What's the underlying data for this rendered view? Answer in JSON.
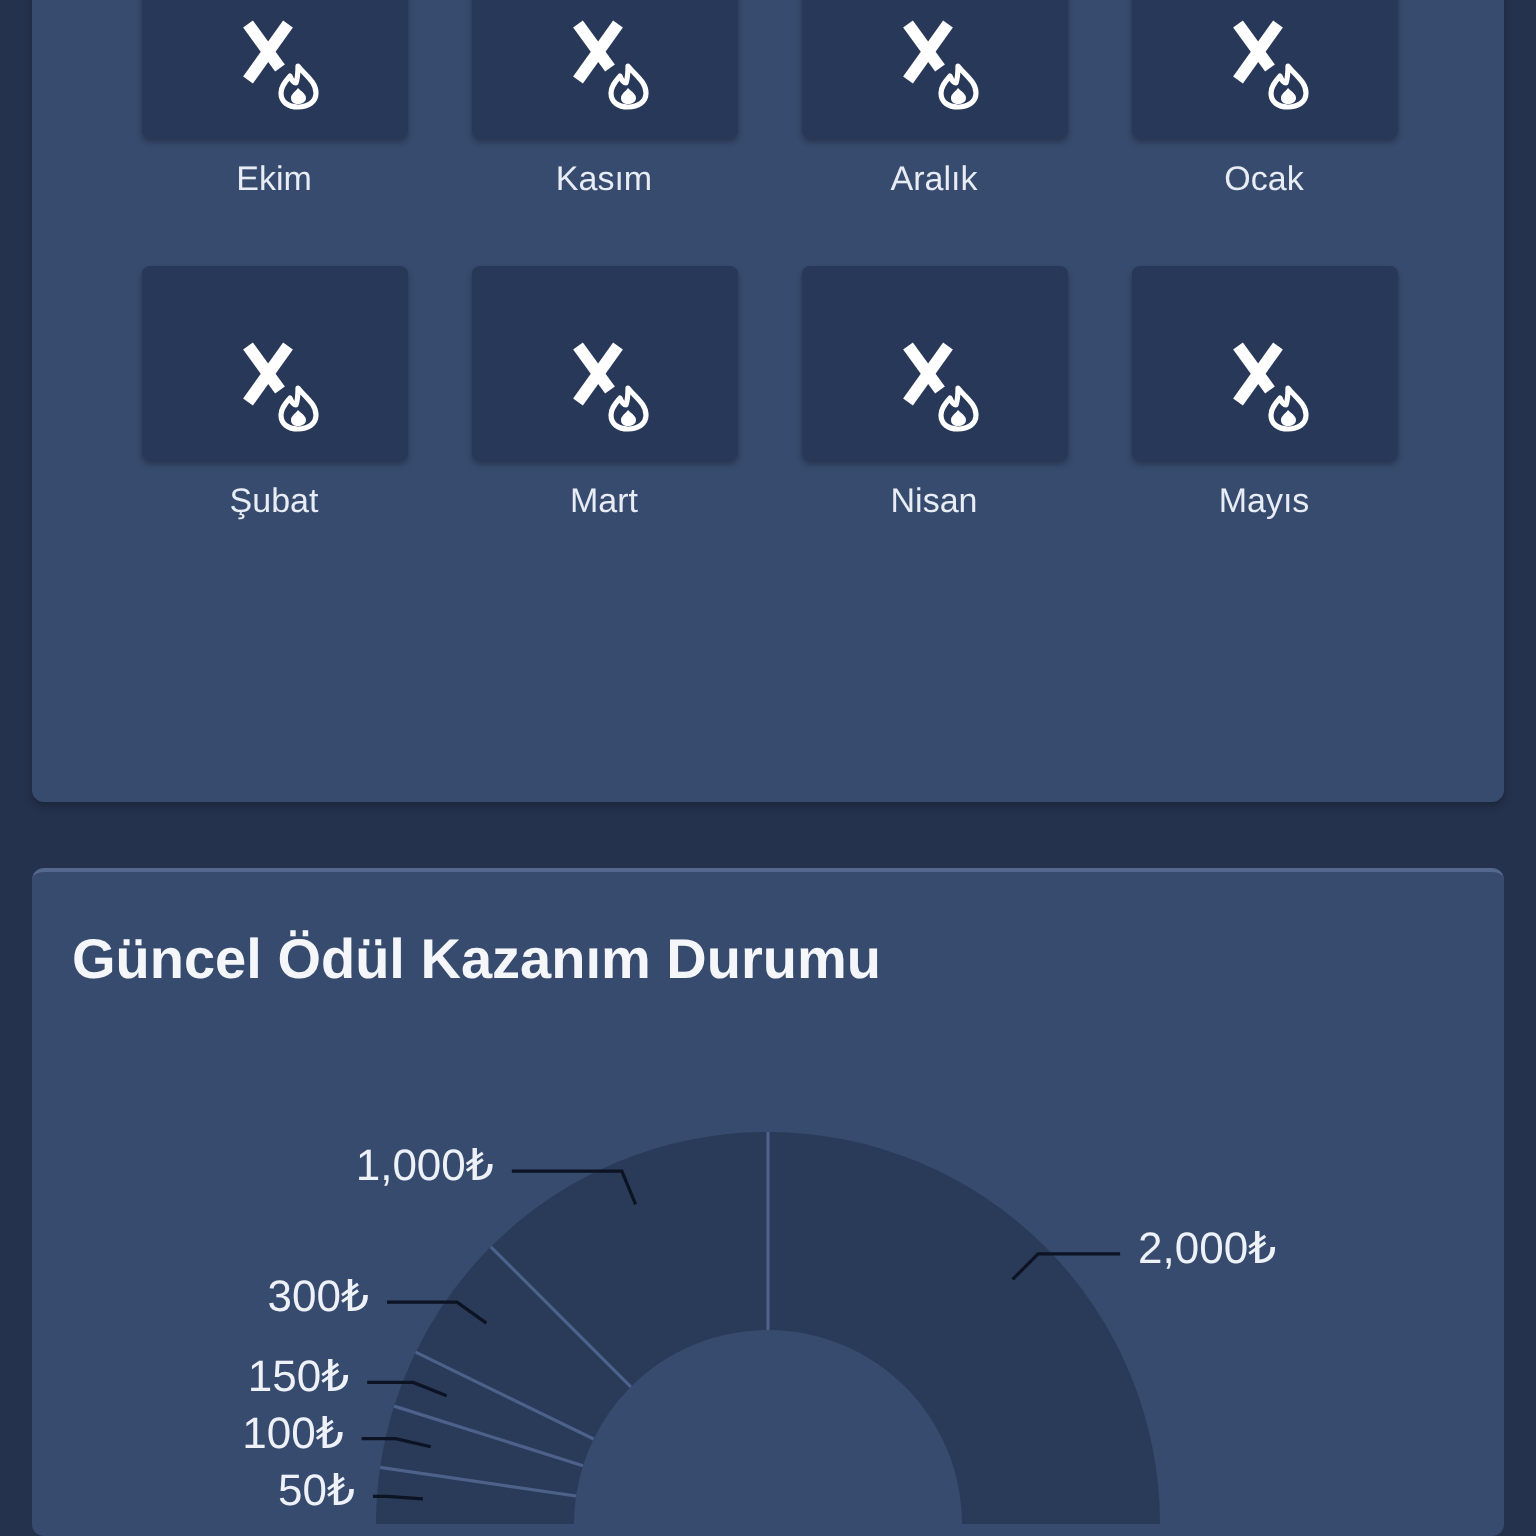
{
  "months_card": {
    "months": [
      {
        "label": "Ekim"
      },
      {
        "label": "Kasım"
      },
      {
        "label": "Aralık"
      },
      {
        "label": "Ocak"
      },
      {
        "label": "Şubat"
      },
      {
        "label": "Mart"
      },
      {
        "label": "Nisan"
      },
      {
        "label": "Mayıs"
      }
    ]
  },
  "reward_card": {
    "title": "Güncel Ödül Kazanım Durumu",
    "reward_chart": {
      "slices": [
        {
          "label": "2,000₺"
        },
        {
          "label": "1,000₺"
        },
        {
          "label": "300₺"
        },
        {
          "label": "150₺"
        },
        {
          "label": "100₺"
        },
        {
          "label": "50₺"
        }
      ]
    }
  }
}
